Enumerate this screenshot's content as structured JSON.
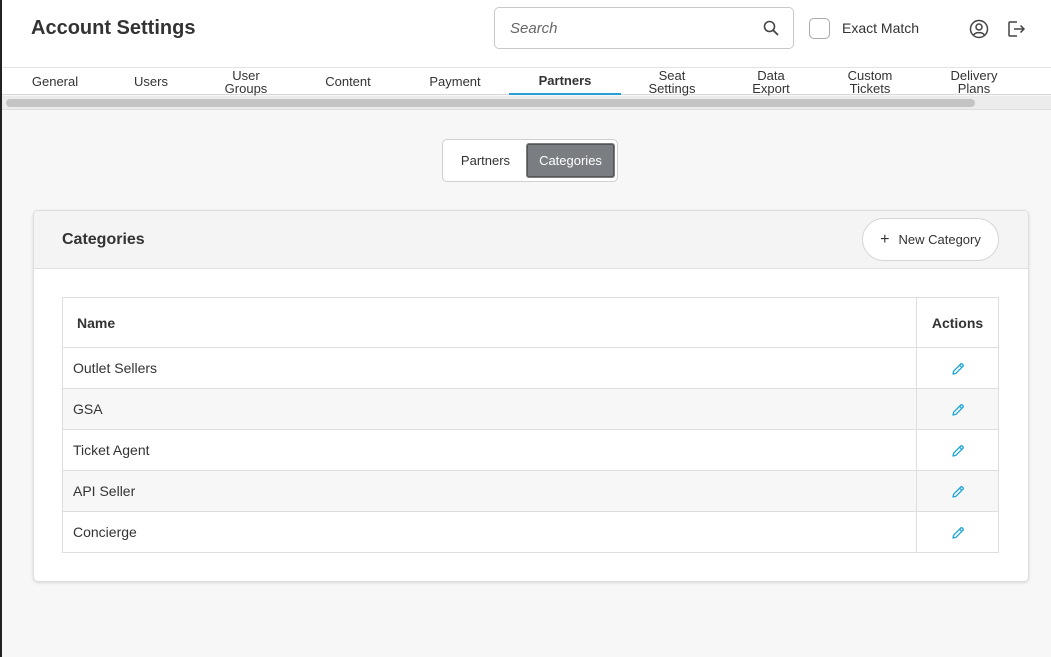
{
  "header": {
    "title": "Account Settings",
    "search_placeholder": "Search",
    "exact_match_label": "Exact Match",
    "exact_match_checked": false,
    "user_icon": "user-circle-icon",
    "logout_icon": "logout-icon"
  },
  "tabs": [
    {
      "label": "General",
      "active": false
    },
    {
      "label": "Users",
      "active": false
    },
    {
      "label": "User\nGroups",
      "active": false
    },
    {
      "label": "Content",
      "active": false
    },
    {
      "label": "Payment",
      "active": false
    },
    {
      "label": "Partners",
      "active": true
    },
    {
      "label": "Seat\nSettings",
      "active": false
    },
    {
      "label": "Data\nExport",
      "active": false
    },
    {
      "label": "Custom\nTickets",
      "active": false
    },
    {
      "label": "Delivery\nPlans",
      "active": false
    }
  ],
  "segments": {
    "partners": "Partners",
    "categories": "Categories",
    "selected": "Categories"
  },
  "card": {
    "title": "Categories",
    "new_button_label": "New Category"
  },
  "table": {
    "columns": [
      "Name",
      "Actions"
    ],
    "rows": [
      {
        "name": "Outlet Sellers",
        "action_icon": "edit-pencil-icon"
      },
      {
        "name": "GSA",
        "action_icon": "edit-pencil-icon"
      },
      {
        "name": "Ticket Agent",
        "action_icon": "edit-pencil-icon"
      },
      {
        "name": "API Seller",
        "action_icon": "edit-pencil-icon"
      },
      {
        "name": "Concierge",
        "action_icon": "edit-pencil-icon"
      }
    ]
  },
  "colors": {
    "accent": "#2a9fd6",
    "segment_active_bg": "#7a7e82",
    "edit_icon": "#1ea5d8"
  }
}
